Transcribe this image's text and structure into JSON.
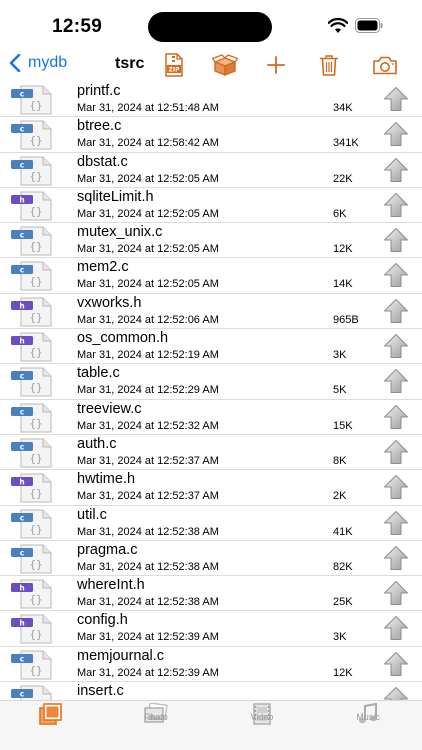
{
  "status": {
    "time": "12:59"
  },
  "nav": {
    "back_label": "mydb",
    "title": "tsrc"
  },
  "files": [
    {
      "name": "printf.c",
      "date": "Mar 31, 2024 at 12:51:48 AM",
      "size": "34K",
      "type": "c"
    },
    {
      "name": "btree.c",
      "date": "Mar 31, 2024 at 12:58:42 AM",
      "size": "341K",
      "type": "c"
    },
    {
      "name": "dbstat.c",
      "date": "Mar 31, 2024 at 12:52:05 AM",
      "size": "22K",
      "type": "c"
    },
    {
      "name": "sqliteLimit.h",
      "date": "Mar 31, 2024 at 12:52:05 AM",
      "size": "6K",
      "type": "h"
    },
    {
      "name": "mutex_unix.c",
      "date": "Mar 31, 2024 at 12:52:05 AM",
      "size": "12K",
      "type": "c"
    },
    {
      "name": "mem2.c",
      "date": "Mar 31, 2024 at 12:52:05 AM",
      "size": "14K",
      "type": "c"
    },
    {
      "name": "vxworks.h",
      "date": "Mar 31, 2024 at 12:52:06 AM",
      "size": "965B",
      "type": "h"
    },
    {
      "name": "os_common.h",
      "date": "Mar 31, 2024 at 12:52:19 AM",
      "size": "3K",
      "type": "h"
    },
    {
      "name": "table.c",
      "date": "Mar 31, 2024 at 12:52:29 AM",
      "size": "5K",
      "type": "c"
    },
    {
      "name": "treeview.c",
      "date": "Mar 31, 2024 at 12:52:32 AM",
      "size": "15K",
      "type": "c"
    },
    {
      "name": "auth.c",
      "date": "Mar 31, 2024 at 12:52:37 AM",
      "size": "8K",
      "type": "c"
    },
    {
      "name": "hwtime.h",
      "date": "Mar 31, 2024 at 12:52:37 AM",
      "size": "2K",
      "type": "h"
    },
    {
      "name": "util.c",
      "date": "Mar 31, 2024 at 12:52:38 AM",
      "size": "41K",
      "type": "c"
    },
    {
      "name": "pragma.c",
      "date": "Mar 31, 2024 at 12:52:38 AM",
      "size": "82K",
      "type": "c"
    },
    {
      "name": "whereInt.h",
      "date": "Mar 31, 2024 at 12:52:38 AM",
      "size": "25K",
      "type": "h"
    },
    {
      "name": "config.h",
      "date": "Mar 31, 2024 at 12:52:39 AM",
      "size": "3K",
      "type": "h"
    },
    {
      "name": "memjournal.c",
      "date": "Mar 31, 2024 at 12:52:39 AM",
      "size": "12K",
      "type": "c"
    },
    {
      "name": "insert.c",
      "date": "",
      "size": "",
      "type": "c"
    }
  ],
  "tabs": [
    {
      "label": "",
      "icon": "files-icon",
      "selected": true
    },
    {
      "label": "Photo",
      "icon": "photo-icon",
      "selected": false
    },
    {
      "label": "Video",
      "icon": "film-icon",
      "selected": false
    },
    {
      "label": "Music",
      "icon": "music-note-icon",
      "selected": false
    }
  ],
  "colors": {
    "accent": "#1a73e8",
    "toolbar_icon": "#d2691e",
    "c_badge": "#4a7fc0",
    "h_badge": "#6b4fc0",
    "tab_selected": "#e8721c",
    "tab_inactive": "#9a9a9a"
  }
}
